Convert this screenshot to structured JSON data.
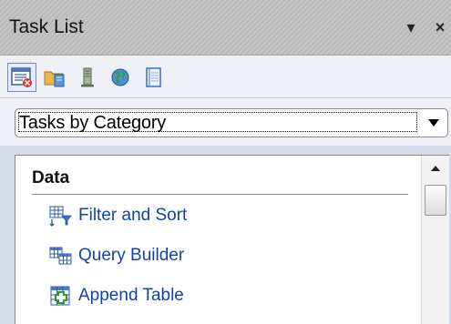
{
  "pane": {
    "title": "Task List",
    "dropdown_glyph": "▾",
    "close_glyph": "×"
  },
  "toolbar": {
    "buttons": [
      {
        "name": "task-list-view",
        "icon": "task-list-icon",
        "active": true
      },
      {
        "name": "folder-view",
        "icon": "folder-icon",
        "active": false
      },
      {
        "name": "server-view",
        "icon": "server-icon",
        "active": false
      },
      {
        "name": "web-view",
        "icon": "globe-icon",
        "active": false
      },
      {
        "name": "notes-view",
        "icon": "notebook-icon",
        "active": false
      }
    ]
  },
  "category_select": {
    "value": "Tasks by Category"
  },
  "section": {
    "header": "Data",
    "items": [
      {
        "label": "Filter and Sort",
        "icon": "filter-sort-icon"
      },
      {
        "label": "Query Builder",
        "icon": "query-builder-icon"
      },
      {
        "label": "Append Table",
        "icon": "append-table-icon"
      }
    ]
  },
  "colors": {
    "link": "#1144aa",
    "accent": "#3a6fc4"
  }
}
